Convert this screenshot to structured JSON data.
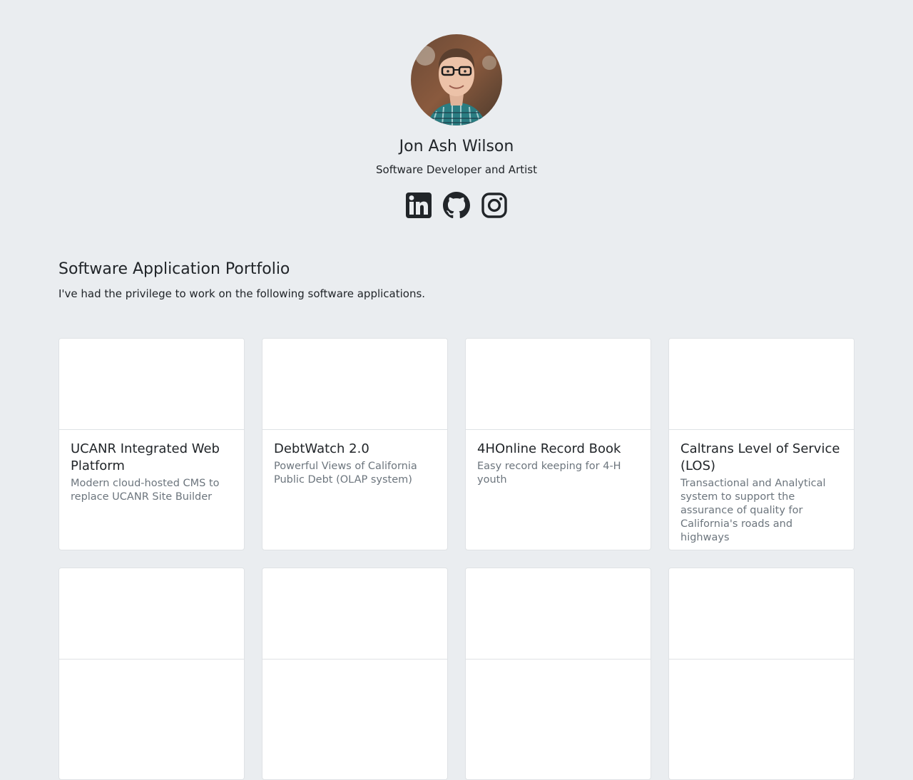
{
  "profile": {
    "name": "Jon Ash Wilson",
    "tagline": "Software Developer and Artist",
    "avatar_icon": "portrait-photo",
    "social": [
      {
        "icon": "linkedin-icon"
      },
      {
        "icon": "github-icon"
      },
      {
        "icon": "instagram-icon"
      }
    ]
  },
  "portfolio": {
    "title": "Software Application Portfolio",
    "intro": "I've had the privilege to work on the following software applications.",
    "cards": [
      {
        "title": "UCANR Integrated Web Platform",
        "text": "Modern cloud-hosted CMS to replace UCANR Site Builder"
      },
      {
        "title": "DebtWatch 2.0",
        "text": "Powerful Views of California Public Debt (OLAP system)"
      },
      {
        "title": "4HOnline Record Book",
        "text": "Easy record keeping for 4-H youth"
      },
      {
        "title": "Caltrans Level of Service (LOS)",
        "text": "Transactional and Analytical system to support the assurance of quality for California's roads and highways"
      },
      {
        "title": "",
        "text": ""
      },
      {
        "title": "",
        "text": ""
      },
      {
        "title": "",
        "text": ""
      },
      {
        "title": "",
        "text": ""
      }
    ]
  },
  "colors": {
    "background": "#eaedf0",
    "text": "#212529",
    "muted": "#6c757d",
    "card": "#ffffff"
  }
}
